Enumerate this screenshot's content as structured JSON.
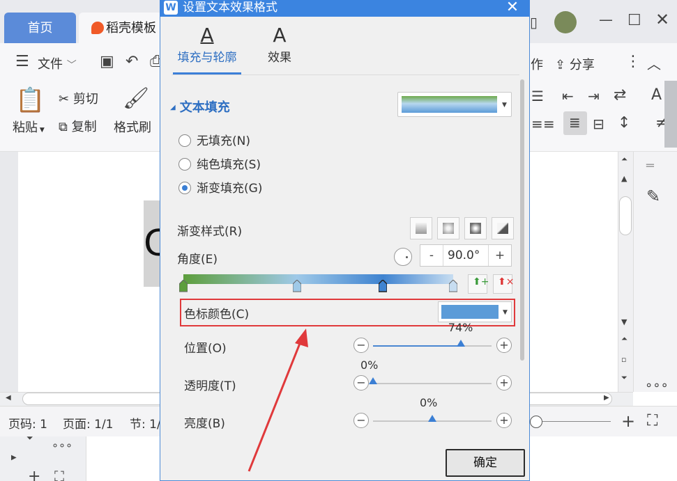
{
  "app": {
    "tabs": [
      {
        "label": "首页"
      },
      {
        "label": "稻壳模板"
      }
    ],
    "toolbar": {
      "file_label": "文件",
      "share_label": "分享",
      "partial_left": "作"
    },
    "ribbon": {
      "paste_label": "粘贴",
      "cut_label": "剪切",
      "copy_label": "复制",
      "format_painter_label": "格式刷"
    },
    "document": {
      "visible_char": "C"
    },
    "status": {
      "page_code": "页码: 1",
      "page": "页面: 1/1",
      "section": "节: 1/"
    }
  },
  "dialog": {
    "title": "设置文本效果格式",
    "tabs": [
      {
        "label": "填充与轮廓",
        "active": true
      },
      {
        "label": "效果",
        "active": false
      }
    ],
    "text_fill": {
      "section_label": "文本填充",
      "options": [
        {
          "label": "无填充(N)",
          "selected": false
        },
        {
          "label": "纯色填充(S)",
          "selected": false
        },
        {
          "label": "渐变填充(G)",
          "selected": true
        }
      ],
      "preview_colors": [
        "#6faa4d",
        "#b7d7ef",
        "#5b9bd8"
      ]
    },
    "gradient_style_label": "渐变样式(R)",
    "angle": {
      "label": "角度(E)",
      "value": "90.0°",
      "minus": "-",
      "plus": "+"
    },
    "gradient_stops": [
      {
        "position": 0,
        "color": "#5d9e3c"
      },
      {
        "position": 42,
        "color": "#9fc9e8"
      },
      {
        "position": 74,
        "color": "#3f83d0"
      },
      {
        "position": 100,
        "color": "#c7ddf1"
      }
    ],
    "stop_color": {
      "label": "色标颜色(C)",
      "color": "#5b9bd8"
    },
    "position": {
      "label": "位置(O)",
      "value": 74,
      "display": "74%"
    },
    "transparency": {
      "label": "透明度(T)",
      "value": 0,
      "display": "0%"
    },
    "brightness": {
      "label": "亮度(B)",
      "value": 50,
      "display": "0%"
    },
    "ok_label": "确定"
  },
  "colors": {
    "accent": "#3b84e0",
    "highlight_box": "#e0393b"
  }
}
